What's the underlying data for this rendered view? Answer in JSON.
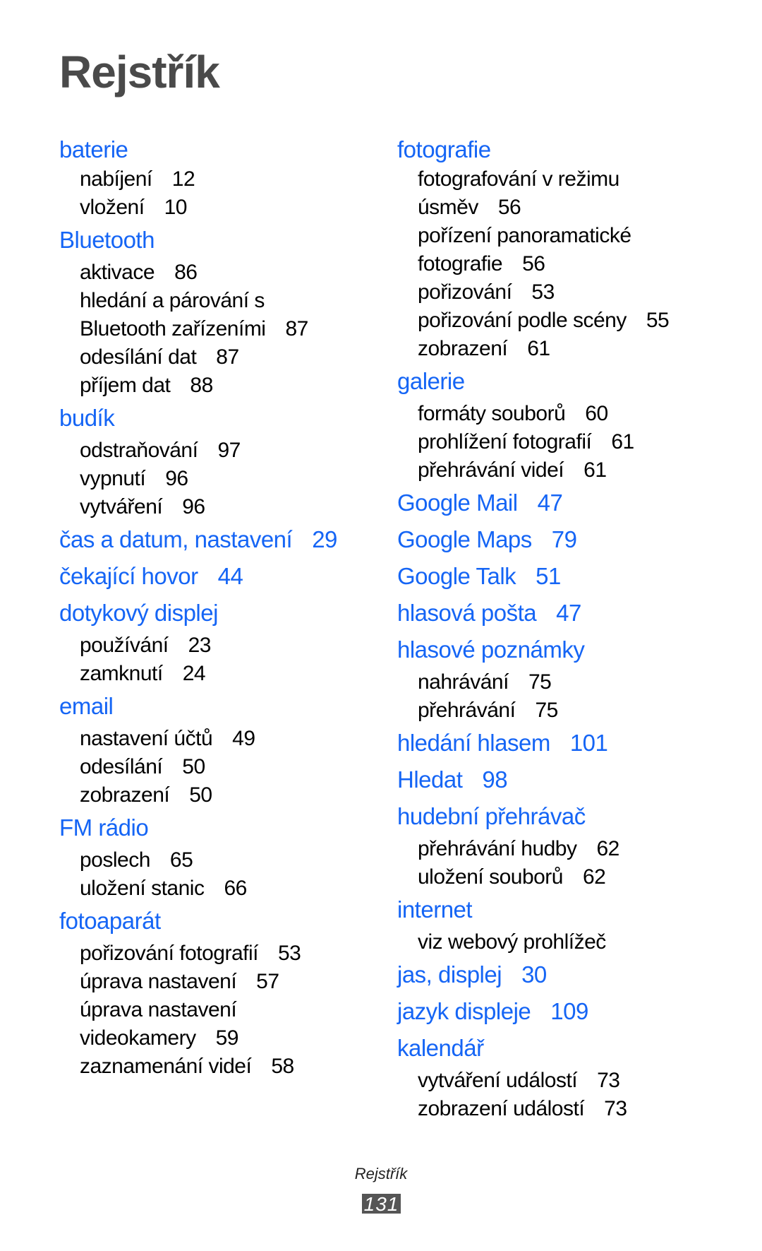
{
  "title": "Rejstřík",
  "colors": {
    "heading": "#1565f5",
    "title": "#4a4a4a",
    "text": "#000000",
    "page_box": "#555555"
  },
  "left_column": [
    {
      "term": "baterie",
      "page": "",
      "subs": [
        {
          "text": "nabíjení",
          "page": "12"
        },
        {
          "text": "vložení",
          "page": "10"
        }
      ]
    },
    {
      "term": "Bluetooth",
      "page": "",
      "subs": [
        {
          "text": "aktivace",
          "page": "86"
        },
        {
          "text": "hledání a párování s",
          "page": ""
        },
        {
          "text": "Bluetooth zařízeními",
          "page": "87"
        },
        {
          "text": "odesílání dat",
          "page": "87"
        },
        {
          "text": "příjem dat",
          "page": "88"
        }
      ]
    },
    {
      "term": "budík",
      "page": "",
      "subs": [
        {
          "text": "odstraňování",
          "page": "97"
        },
        {
          "text": "vypnutí",
          "page": "96"
        },
        {
          "text": "vytváření",
          "page": "96"
        }
      ]
    },
    {
      "term": "čas a datum, nastavení",
      "page": "29",
      "subs": []
    },
    {
      "term": "čekající hovor",
      "page": "44",
      "subs": []
    },
    {
      "term": "dotykový displej",
      "page": "",
      "subs": [
        {
          "text": "používání",
          "page": "23"
        },
        {
          "text": "zamknutí",
          "page": "24"
        }
      ]
    },
    {
      "term": "email",
      "page": "",
      "subs": [
        {
          "text": "nastavení účtů",
          "page": "49"
        },
        {
          "text": "odesílání",
          "page": "50"
        },
        {
          "text": "zobrazení",
          "page": "50"
        }
      ]
    },
    {
      "term": "FM rádio",
      "page": "",
      "subs": [
        {
          "text": "poslech",
          "page": "65"
        },
        {
          "text": "uložení stanic",
          "page": "66"
        }
      ]
    },
    {
      "term": "fotoaparát",
      "page": "",
      "subs": [
        {
          "text": "pořizování fotografií",
          "page": "53"
        },
        {
          "text": "úprava nastavení",
          "page": "57"
        },
        {
          "text": "úprava nastavení",
          "page": ""
        },
        {
          "text": "videokamery",
          "page": "59"
        },
        {
          "text": "zaznamenání videí",
          "page": "58"
        }
      ]
    }
  ],
  "right_column": [
    {
      "term": "fotografie",
      "page": "",
      "subs": [
        {
          "text": "fotografování v režimu",
          "page": ""
        },
        {
          "text": "úsměv",
          "page": "56"
        },
        {
          "text": "pořízení panoramatické",
          "page": ""
        },
        {
          "text": "fotografie",
          "page": "56"
        },
        {
          "text": "pořizování",
          "page": "53"
        },
        {
          "text": "pořizování podle scény",
          "page": "55"
        },
        {
          "text": "zobrazení",
          "page": "61"
        }
      ]
    },
    {
      "term": "galerie",
      "page": "",
      "subs": [
        {
          "text": "formáty souborů",
          "page": "60"
        },
        {
          "text": "prohlížení fotografií",
          "page": "61"
        },
        {
          "text": "přehrávání videí",
          "page": "61"
        }
      ]
    },
    {
      "term": "Google Mail",
      "page": "47",
      "subs": []
    },
    {
      "term": "Google Maps",
      "page": "79",
      "subs": []
    },
    {
      "term": "Google Talk",
      "page": "51",
      "subs": []
    },
    {
      "term": "hlasová pošta",
      "page": "47",
      "subs": []
    },
    {
      "term": "hlasové poznámky",
      "page": "",
      "subs": [
        {
          "text": "nahrávání",
          "page": "75"
        },
        {
          "text": "přehrávání",
          "page": "75"
        }
      ]
    },
    {
      "term": "hledání hlasem",
      "page": "101",
      "subs": []
    },
    {
      "term": "Hledat",
      "page": "98",
      "subs": []
    },
    {
      "term": "hudební přehrávač",
      "page": "",
      "subs": [
        {
          "text": "přehrávání hudby",
          "page": "62"
        },
        {
          "text": "uložení souborů",
          "page": "62"
        }
      ]
    },
    {
      "term": "internet",
      "page": "",
      "subs": [
        {
          "text": "viz webový prohlížeč",
          "page": ""
        }
      ]
    },
    {
      "term": "jas, displej",
      "page": "30",
      "subs": []
    },
    {
      "term": "jazyk displeje",
      "page": "109",
      "subs": []
    },
    {
      "term": "kalendář",
      "page": "",
      "subs": [
        {
          "text": "vytváření událostí",
          "page": "73"
        },
        {
          "text": "zobrazení událostí",
          "page": "73"
        }
      ]
    }
  ],
  "footer": {
    "section": "Rejstřík",
    "page_number": "131"
  }
}
